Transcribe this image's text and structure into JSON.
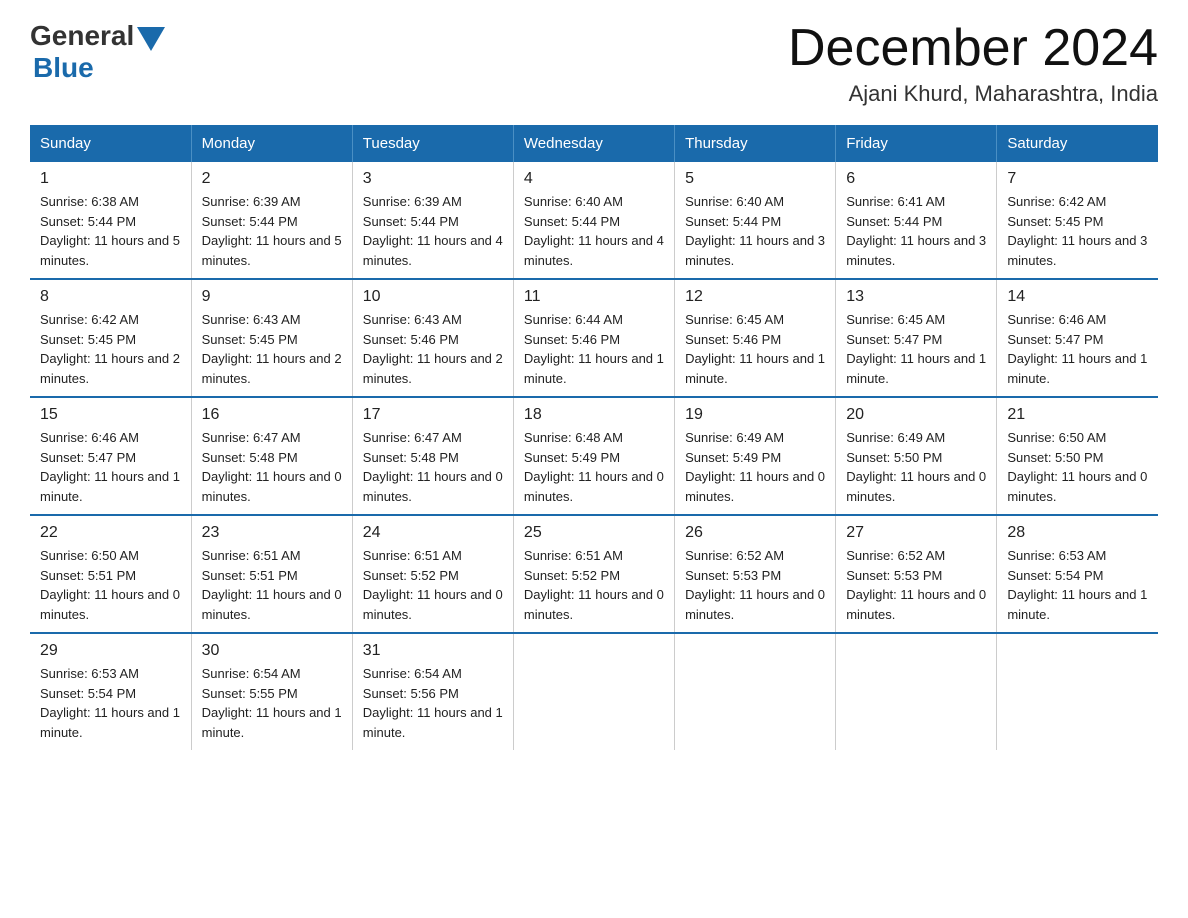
{
  "header": {
    "logo_general": "General",
    "logo_blue": "Blue",
    "month_title": "December 2024",
    "location": "Ajani Khurd, Maharashtra, India"
  },
  "columns": [
    "Sunday",
    "Monday",
    "Tuesday",
    "Wednesday",
    "Thursday",
    "Friday",
    "Saturday"
  ],
  "weeks": [
    [
      {
        "day": "1",
        "sunrise": "6:38 AM",
        "sunset": "5:44 PM",
        "daylight": "11 hours and 5 minutes."
      },
      {
        "day": "2",
        "sunrise": "6:39 AM",
        "sunset": "5:44 PM",
        "daylight": "11 hours and 5 minutes."
      },
      {
        "day": "3",
        "sunrise": "6:39 AM",
        "sunset": "5:44 PM",
        "daylight": "11 hours and 4 minutes."
      },
      {
        "day": "4",
        "sunrise": "6:40 AM",
        "sunset": "5:44 PM",
        "daylight": "11 hours and 4 minutes."
      },
      {
        "day": "5",
        "sunrise": "6:40 AM",
        "sunset": "5:44 PM",
        "daylight": "11 hours and 3 minutes."
      },
      {
        "day": "6",
        "sunrise": "6:41 AM",
        "sunset": "5:44 PM",
        "daylight": "11 hours and 3 minutes."
      },
      {
        "day": "7",
        "sunrise": "6:42 AM",
        "sunset": "5:45 PM",
        "daylight": "11 hours and 3 minutes."
      }
    ],
    [
      {
        "day": "8",
        "sunrise": "6:42 AM",
        "sunset": "5:45 PM",
        "daylight": "11 hours and 2 minutes."
      },
      {
        "day": "9",
        "sunrise": "6:43 AM",
        "sunset": "5:45 PM",
        "daylight": "11 hours and 2 minutes."
      },
      {
        "day": "10",
        "sunrise": "6:43 AM",
        "sunset": "5:46 PM",
        "daylight": "11 hours and 2 minutes."
      },
      {
        "day": "11",
        "sunrise": "6:44 AM",
        "sunset": "5:46 PM",
        "daylight": "11 hours and 1 minute."
      },
      {
        "day": "12",
        "sunrise": "6:45 AM",
        "sunset": "5:46 PM",
        "daylight": "11 hours and 1 minute."
      },
      {
        "day": "13",
        "sunrise": "6:45 AM",
        "sunset": "5:47 PM",
        "daylight": "11 hours and 1 minute."
      },
      {
        "day": "14",
        "sunrise": "6:46 AM",
        "sunset": "5:47 PM",
        "daylight": "11 hours and 1 minute."
      }
    ],
    [
      {
        "day": "15",
        "sunrise": "6:46 AM",
        "sunset": "5:47 PM",
        "daylight": "11 hours and 1 minute."
      },
      {
        "day": "16",
        "sunrise": "6:47 AM",
        "sunset": "5:48 PM",
        "daylight": "11 hours and 0 minutes."
      },
      {
        "day": "17",
        "sunrise": "6:47 AM",
        "sunset": "5:48 PM",
        "daylight": "11 hours and 0 minutes."
      },
      {
        "day": "18",
        "sunrise": "6:48 AM",
        "sunset": "5:49 PM",
        "daylight": "11 hours and 0 minutes."
      },
      {
        "day": "19",
        "sunrise": "6:49 AM",
        "sunset": "5:49 PM",
        "daylight": "11 hours and 0 minutes."
      },
      {
        "day": "20",
        "sunrise": "6:49 AM",
        "sunset": "5:50 PM",
        "daylight": "11 hours and 0 minutes."
      },
      {
        "day": "21",
        "sunrise": "6:50 AM",
        "sunset": "5:50 PM",
        "daylight": "11 hours and 0 minutes."
      }
    ],
    [
      {
        "day": "22",
        "sunrise": "6:50 AM",
        "sunset": "5:51 PM",
        "daylight": "11 hours and 0 minutes."
      },
      {
        "day": "23",
        "sunrise": "6:51 AM",
        "sunset": "5:51 PM",
        "daylight": "11 hours and 0 minutes."
      },
      {
        "day": "24",
        "sunrise": "6:51 AM",
        "sunset": "5:52 PM",
        "daylight": "11 hours and 0 minutes."
      },
      {
        "day": "25",
        "sunrise": "6:51 AM",
        "sunset": "5:52 PM",
        "daylight": "11 hours and 0 minutes."
      },
      {
        "day": "26",
        "sunrise": "6:52 AM",
        "sunset": "5:53 PM",
        "daylight": "11 hours and 0 minutes."
      },
      {
        "day": "27",
        "sunrise": "6:52 AM",
        "sunset": "5:53 PM",
        "daylight": "11 hours and 0 minutes."
      },
      {
        "day": "28",
        "sunrise": "6:53 AM",
        "sunset": "5:54 PM",
        "daylight": "11 hours and 1 minute."
      }
    ],
    [
      {
        "day": "29",
        "sunrise": "6:53 AM",
        "sunset": "5:54 PM",
        "daylight": "11 hours and 1 minute."
      },
      {
        "day": "30",
        "sunrise": "6:54 AM",
        "sunset": "5:55 PM",
        "daylight": "11 hours and 1 minute."
      },
      {
        "day": "31",
        "sunrise": "6:54 AM",
        "sunset": "5:56 PM",
        "daylight": "11 hours and 1 minute."
      },
      {
        "day": "",
        "sunrise": "",
        "sunset": "",
        "daylight": ""
      },
      {
        "day": "",
        "sunrise": "",
        "sunset": "",
        "daylight": ""
      },
      {
        "day": "",
        "sunrise": "",
        "sunset": "",
        "daylight": ""
      },
      {
        "day": "",
        "sunrise": "",
        "sunset": "",
        "daylight": ""
      }
    ]
  ]
}
